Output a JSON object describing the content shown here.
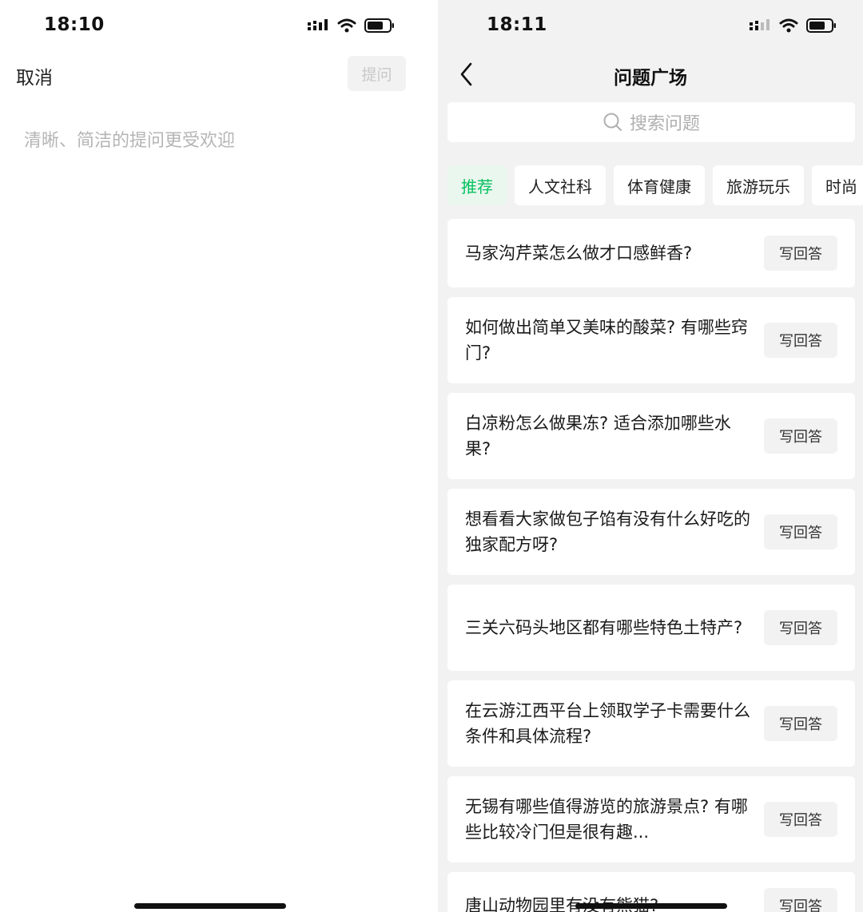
{
  "left_screen": {
    "status_time": "18:10",
    "cancel_label": "取消",
    "ask_button_label": "提问",
    "input_placeholder": "清晰、简洁的提问更受欢迎"
  },
  "right_screen": {
    "status_time": "18:11",
    "title": "问题广场",
    "search_placeholder": "搜索问题",
    "tabs": [
      "推荐",
      "人文社科",
      "体育健康",
      "旅游玩乐",
      "时尚"
    ],
    "answer_label": "写回答",
    "questions": [
      "马家沟芹菜怎么做才口感鲜香?",
      "如何做出简单又美味的酸菜? 有哪些窍门?",
      "白凉粉怎么做果冻? 适合添加哪些水果?",
      "想看看大家做包子馅有没有什么好吃的独家配方呀?",
      "三关六码头地区都有哪些特色土特产?",
      "在云游江西平台上领取学子卡需要什么条件和具体流程?",
      "无锡有哪些值得游览的旅游景点? 有哪些比较冷门但是很有趣...",
      "唐山动物园里有没有熊猫?"
    ]
  },
  "colors": {
    "accent_green": "#07c160",
    "background_gray": "#f2f2f2"
  },
  "icons": [
    "signal-icon",
    "wifi-icon",
    "battery-icon",
    "back-chevron-icon",
    "search-icon"
  ]
}
